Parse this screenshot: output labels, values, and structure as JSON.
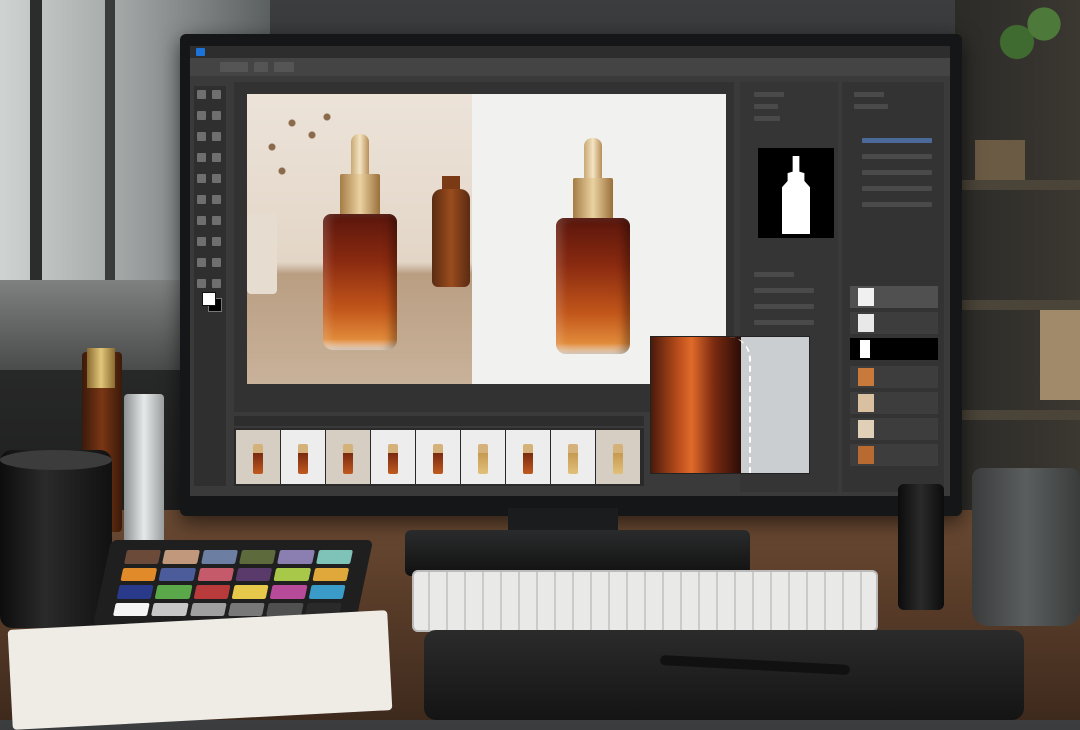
{
  "scene": "photo-editing-workstation",
  "colors": {
    "menubar": "#2d2d2d",
    "ui_panel": "#353535",
    "accent_blue": "#1c73d8",
    "bottle_amber": "#c2561a",
    "collar_gold": "#ead2a0"
  },
  "swatch_colors": [
    "#6c4a3a",
    "#c2987c",
    "#6c7fa2",
    "#5d6b3c",
    "#8a7fb0",
    "#7fc3b8",
    "#e08a2a",
    "#4c5c9a",
    "#c45a6a",
    "#5a3a6a",
    "#a8c84a",
    "#e0a83a",
    "#2a3a8a",
    "#5aa84a",
    "#b83a3a",
    "#e6c84a",
    "#b84a9a",
    "#3a9ac8",
    "#f4f4f4",
    "#c8c8c8",
    "#a0a0a0",
    "#787878",
    "#505050",
    "#2a2a2a"
  ]
}
